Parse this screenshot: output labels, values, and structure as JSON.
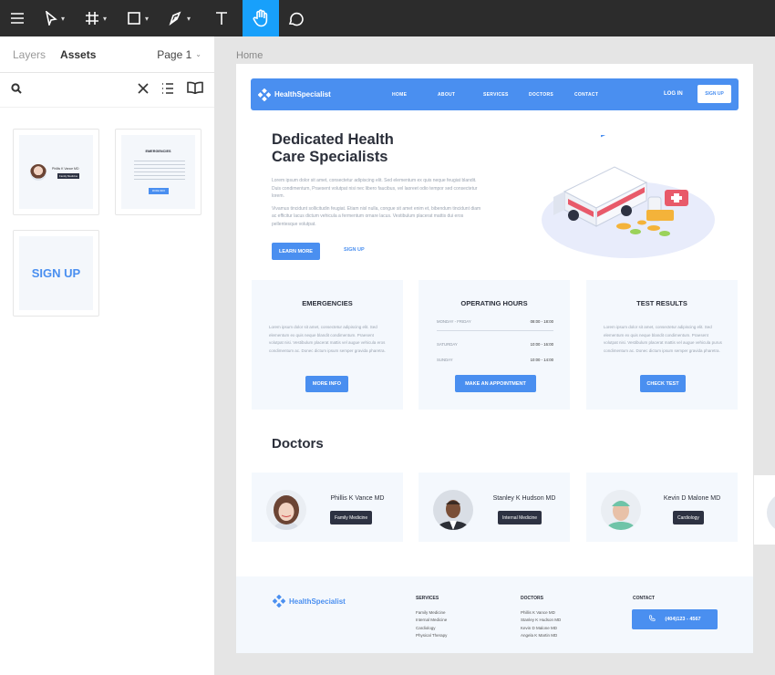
{
  "toolbar": {
    "icons": [
      "menu-icon",
      "move-tool-icon",
      "frame-tool-icon",
      "shape-tool-icon",
      "pen-tool-icon",
      "text-tool-icon",
      "hand-tool-icon",
      "comment-icon"
    ],
    "active": "hand-tool-icon",
    "accent": "#18a0fb"
  },
  "panel": {
    "tabs": [
      "Layers",
      "Assets"
    ],
    "active_tab": "Assets",
    "page_label": "Page 1",
    "assets": {
      "doctor_card": {
        "name": "Phillis K Vance MD",
        "tag": "Family Medicine"
      },
      "emergency_card": {
        "title": "EMERGENCIES",
        "button": "MORE INFO"
      },
      "signup_button": "SIGN UP"
    }
  },
  "canvas": {
    "frame_label": "Home",
    "nav": {
      "brand": "HealthSpecialist",
      "links": [
        "HOME",
        "ABOUT",
        "SERVICES",
        "DOCTORS",
        "CONTACT"
      ],
      "login": "LOG IN",
      "signup": "SIGN UP",
      "color": "#4a8ff0"
    },
    "hero": {
      "title_line1": "Dedicated Health",
      "title_line2": "Care Specialists",
      "para1": "Lorem ipsum dolor sit amet, consectetur adipiscing elit. Sed elementum ex quis neque feugiat blandit. Duis condimentum, Praesent volutpat nisi nec libero faucibus, vel laoreet odio tempor sed consectetur lorem.",
      "para2": "Vivamus tincidunt sollicitudin feugiat. Etiam nisl nulla, congue sit amet enim et, bibendum tincidunt diam ac efficitur lacus dictum vehicula a fermentum ornare lacus. Vestibulum placerat mattis dui eros pellentesque volutpat.",
      "learn_more": "LEARN MORE",
      "signup": "SIGN UP"
    },
    "cards": [
      {
        "title": "EMERGENCIES",
        "text": "Lorem ipsum dolor sit amet, consectetur adipiscing elit. Sed elementum ex quis neque blandit condimentum. Praesent volutpat nisi. Vestibulum placerat mattis vel augue vehicula eros condimentum ac. Donec dictum ipsum semper gravida pharetra.",
        "button": "MORE INFO"
      },
      {
        "title": "OPERATING HOURS",
        "hours": [
          {
            "day": "MONDAY - FRIDAY",
            "time": "08:00 - 18:00"
          },
          {
            "day": "SATURDAY",
            "time": "10:00 - 16:00"
          },
          {
            "day": "SUNDAY",
            "time": "10:00 - 14:00"
          }
        ],
        "button": "MAKE AN APPOINTMENT"
      },
      {
        "title": "TEST RESULTS",
        "text": "Lorem ipsum dolor sit amet, consectetur adipiscing elit. Sed elementum ex quis neque blandit condimentum. Praesent volutpat nisi. Vestibulum placerat mattis vel augue vehicula purus condimentum ac. Donec dictum ipsum semper gravida pharetra.",
        "button": "CHECK TEST"
      }
    ],
    "doctors_heading": "Doctors",
    "doctors": [
      {
        "name": "Phillis K Vance MD",
        "specialty": "Family Medicine"
      },
      {
        "name": "Stanley K Hudson MD",
        "specialty": "Internal Medicine"
      },
      {
        "name": "Kevin D Malone MD",
        "specialty": "Cardiology"
      }
    ],
    "footer": {
      "brand": "HealthSpecialist",
      "services_h": "SERVICES",
      "services": [
        "Family Medicine",
        "Internal Medicine",
        "Cardiology",
        "Physical Therapy"
      ],
      "doctors_h": "DOCTORS",
      "doctors": [
        "Phillis K Vance MD",
        "Stanley K Hudson MD",
        "Kevin D Malone MD",
        "Angela K Martin MD"
      ],
      "contact_h": "CONTACT",
      "phone": "(404)123 - 4567"
    }
  }
}
